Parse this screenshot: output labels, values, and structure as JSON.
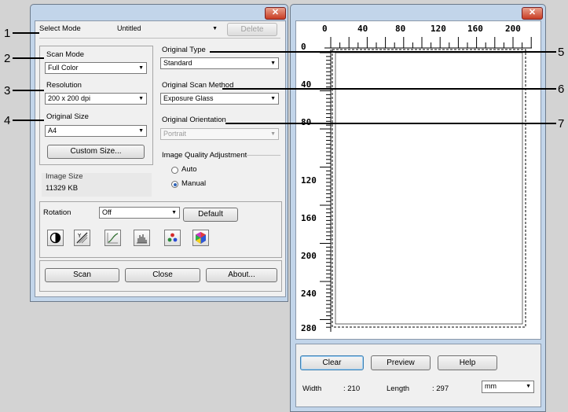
{
  "callouts": [
    "1",
    "2",
    "3",
    "4",
    "5",
    "6",
    "7"
  ],
  "left_window": {
    "close_glyph": "✕",
    "select_mode": {
      "label": "Select Mode",
      "value": "Untitled",
      "delete_label": "Delete"
    },
    "scan_mode": {
      "label": "Scan Mode",
      "value": "Full Color"
    },
    "resolution": {
      "label": "Resolution",
      "value": "200 x 200 dpi"
    },
    "original_size": {
      "label": "Original Size",
      "value": "A4",
      "custom_button": "Custom Size..."
    },
    "image_size": {
      "label": "Image Size",
      "value": "11329 KB"
    },
    "original_type": {
      "label": "Original Type",
      "value": "Standard"
    },
    "scan_method": {
      "label": "Original Scan Method",
      "value": "Exposure Glass"
    },
    "orientation": {
      "label": "Original Orientation",
      "value": "Portrait"
    },
    "quality": {
      "label": "Image Quality Adjustment",
      "options": [
        "Auto",
        "Manual"
      ],
      "selected": "Manual"
    },
    "rotation": {
      "label": "Rotation",
      "value": "Off",
      "default_button": "Default"
    },
    "adjust_icons": [
      "brightness-contrast-icon",
      "gamma-icon",
      "tone-curve-icon",
      "histogram-icon",
      "color-balance-icon",
      "color-adjust-icon"
    ],
    "bottom_buttons": {
      "scan": "Scan",
      "close": "Close",
      "about": "About..."
    }
  },
  "right_window": {
    "close_glyph": "✕",
    "ruler_h": [
      "0",
      "40",
      "80",
      "120",
      "160",
      "200"
    ],
    "ruler_v": [
      "0",
      "40",
      "80",
      "120",
      "160",
      "200",
      "240",
      "280"
    ],
    "buttons": {
      "clear": "Clear",
      "preview": "Preview",
      "help": "Help"
    },
    "width": {
      "label": "Width",
      "value": ": 210"
    },
    "length": {
      "label": "Length",
      "value": ": 297"
    },
    "unit": "mm"
  }
}
